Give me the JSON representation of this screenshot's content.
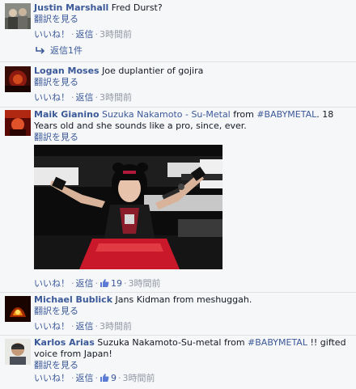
{
  "ui": {
    "like": "いいね！",
    "reply": "返信",
    "translate": "翻訳を見る",
    "dot": "·"
  },
  "comments": [
    {
      "author": "Justin Marshall",
      "text": "Fred Durst?",
      "time": "3時間前",
      "likes": null,
      "replies_label": "返信1件"
    },
    {
      "author": "Logan Moses",
      "text": "Joe duplantier of gojira",
      "time": null,
      "likes": null
    },
    {
      "author": "Maik Gianino",
      "mention": "Suzuka Nakamoto - Su-Metal",
      "text_mid": " from ",
      "hashtag": "#BABYMETAL",
      "text_end": ". 18 Years old and she sounds like a pro, since, ever.",
      "time": "3時間前",
      "likes": "19"
    },
    {
      "author": "Michael Bublick",
      "text": "Jans Kidman from meshuggah.",
      "time": "3時間前",
      "likes": null
    },
    {
      "author": "Karlos Arias",
      "text_start": "Suzuka Nakamoto-Su-metal from ",
      "hashtag": "#BABYMETAL",
      "text_end": " !! gifted voice from Japan!",
      "time": "3時間前",
      "likes": "9"
    }
  ],
  "colors": {
    "link": "#3b5998",
    "meta": "#9197a3",
    "text": "#141823",
    "background": "#f6f7f9"
  },
  "icons": [
    "thumbs-up-icon",
    "reply-arrow-icon"
  ]
}
